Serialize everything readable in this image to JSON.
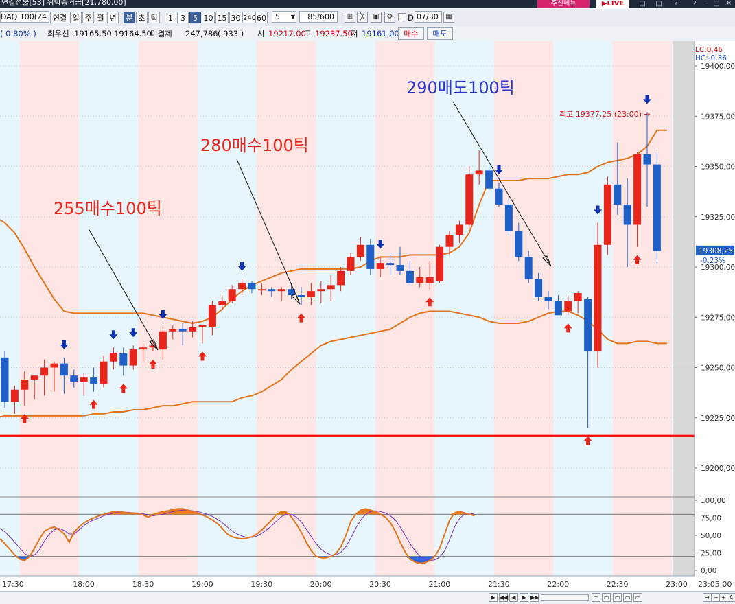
{
  "window": {
    "title": "연결선물[53]  위탁증거금[21,780.00]",
    "badge": "주신메뉴",
    "live_badge": "▶LIVE",
    "controls": [
      "□",
      "□",
      "?",
      "?",
      "─",
      "□",
      "✕"
    ]
  },
  "toolbar": {
    "symbol": "DAQ 100(24.0",
    "period_buttons": [
      {
        "label": "연결",
        "selected": false
      },
      {
        "label": "일",
        "selected": false
      },
      {
        "label": "주",
        "selected": false
      },
      {
        "label": "월",
        "selected": false
      },
      {
        "label": "년",
        "selected": false
      },
      {
        "label": "분",
        "selected": true
      },
      {
        "label": "초",
        "selected": false
      },
      {
        "label": "틱",
        "selected": false
      },
      {
        "label": "1",
        "selected": false
      },
      {
        "label": "3",
        "selected": false
      },
      {
        "label": "5",
        "selected": true
      },
      {
        "label": "10",
        "selected": false
      },
      {
        "label": "15",
        "selected": false
      },
      {
        "label": "30",
        "selected": false
      },
      {
        "label": "240",
        "selected": false
      },
      {
        "label": "60",
        "selected": false
      }
    ],
    "interval_value": "5",
    "count_value": "85/600",
    "d_label": "D",
    "date_value": "07/30"
  },
  "quote": {
    "change_pct": "(    0.80%  )",
    "best_label": "최우선",
    "best_ask": "19165.50",
    "best_bid": "19164.50",
    "oi_label": "미결제",
    "oi_value": "247,786",
    "oi_change": "(    933    )",
    "open_label": "시",
    "open": "19217.00",
    "high_label": "고",
    "high": "19237.50",
    "low_label": "저",
    "low": "19161.00",
    "buy_button": "매수",
    "sell_button": "매도"
  },
  "chart_data": {
    "type": "candlestick",
    "ylim": [
      19190,
      19415
    ],
    "price_ticks": [
      "19400,00",
      "19375,00",
      "19350,00",
      "19325,00",
      "19300,00",
      "19275,00",
      "19250,00",
      "19225,00",
      "19200,00"
    ],
    "time_labels": [
      "17:30",
      "18:00",
      "18:30",
      "19:00",
      "19:30",
      "20:00",
      "20:30",
      "21:00",
      "21:30",
      "22:00",
      "22:30",
      "23:00",
      "23:05:00"
    ],
    "lc_label": "LC:0,46",
    "hc_label": "HC:-0,36",
    "current_price": "19308,25",
    "current_change": "-0,23%",
    "high_marker": "최고 19377,25 (23:00) →",
    "support_level": 19216,
    "annotations": [
      "255매수100틱",
      "280매수100틱",
      "290매도100틱"
    ],
    "candles": [
      {
        "time": "17:20",
        "open": 19263,
        "high": 19265,
        "low": 19255,
        "close": 19255
      },
      {
        "time": "17:25",
        "open": 19255,
        "high": 19258,
        "low": 19230,
        "close": 19233
      },
      {
        "time": "17:30",
        "open": 19233,
        "high": 19241,
        "low": 19227,
        "close": 19239
      },
      {
        "time": "17:35",
        "open": 19239,
        "high": 19248,
        "low": 19231,
        "close": 19244
      },
      {
        "time": "17:40",
        "open": 19244,
        "high": 19246,
        "low": 19234,
        "close": 19246
      },
      {
        "time": "17:45",
        "open": 19246,
        "high": 19254,
        "low": 19236,
        "close": 19250
      },
      {
        "time": "17:50",
        "open": 19250,
        "high": 19253,
        "low": 19238,
        "close": 19252
      },
      {
        "time": "17:55",
        "open": 19252,
        "high": 19255,
        "low": 19237,
        "close": 19246
      },
      {
        "time": "18:00",
        "open": 19246,
        "high": 19249,
        "low": 19240,
        "close": 19243
      },
      {
        "time": "18:05",
        "open": 19243,
        "high": 19247,
        "low": 19236,
        "close": 19245
      },
      {
        "time": "18:10",
        "open": 19245,
        "high": 19250,
        "low": 19238,
        "close": 19242
      },
      {
        "time": "18:15",
        "open": 19242,
        "high": 19256,
        "low": 19240,
        "close": 19253
      },
      {
        "time": "18:20",
        "open": 19253,
        "high": 19260,
        "low": 19249,
        "close": 19257
      },
      {
        "time": "18:25",
        "open": 19257,
        "high": 19260,
        "low": 19246,
        "close": 19251
      },
      {
        "time": "18:30",
        "open": 19251,
        "high": 19261,
        "low": 19249,
        "close": 19259
      },
      {
        "time": "18:35",
        "open": 19259,
        "high": 19262,
        "low": 19253,
        "close": 19260
      },
      {
        "time": "18:40",
        "open": 19260,
        "high": 19264,
        "low": 19258,
        "close": 19261
      },
      {
        "time": "18:45",
        "open": 19259,
        "high": 19270,
        "low": 19254,
        "close": 19268
      },
      {
        "time": "18:50",
        "open": 19268,
        "high": 19271,
        "low": 19264,
        "close": 19269
      },
      {
        "time": "18:55",
        "open": 19269,
        "high": 19272,
        "low": 19261,
        "close": 19268
      },
      {
        "time": "19:00",
        "open": 19268,
        "high": 19273,
        "low": 19265,
        "close": 19270
      },
      {
        "time": "19:05",
        "open": 19270,
        "high": 19271,
        "low": 19262,
        "close": 19271
      },
      {
        "time": "19:10",
        "open": 19270,
        "high": 19283,
        "low": 19266,
        "close": 19281
      },
      {
        "time": "19:15",
        "open": 19281,
        "high": 19286,
        "low": 19279,
        "close": 19283
      },
      {
        "time": "19:20",
        "open": 19283,
        "high": 19291,
        "low": 19282,
        "close": 19289
      },
      {
        "time": "19:25",
        "open": 19289,
        "high": 19294,
        "low": 19286,
        "close": 19292
      },
      {
        "time": "19:30",
        "open": 19292,
        "high": 19293,
        "low": 19287,
        "close": 19289
      },
      {
        "time": "19:35",
        "open": 19289,
        "high": 19292,
        "low": 19286,
        "close": 19289
      },
      {
        "time": "19:40",
        "open": 19289,
        "high": 19290,
        "low": 19285,
        "close": 19288
      },
      {
        "time": "19:45",
        "open": 19288,
        "high": 19290,
        "low": 19283,
        "close": 19289
      },
      {
        "time": "19:50",
        "open": 19289,
        "high": 19292,
        "low": 19284,
        "close": 19286
      },
      {
        "time": "19:55",
        "open": 19286,
        "high": 19290,
        "low": 19281,
        "close": 19285
      },
      {
        "time": "20:00",
        "open": 19285,
        "high": 19292,
        "low": 19281,
        "close": 19288
      },
      {
        "time": "20:05",
        "open": 19288,
        "high": 19293,
        "low": 19282,
        "close": 19289
      },
      {
        "time": "20:10",
        "open": 19289,
        "high": 19296,
        "low": 19283,
        "close": 19291
      },
      {
        "time": "20:15",
        "open": 19291,
        "high": 19300,
        "low": 19288,
        "close": 19298
      },
      {
        "time": "20:20",
        "open": 19298,
        "high": 19307,
        "low": 19296,
        "close": 19305
      },
      {
        "time": "20:25",
        "open": 19305,
        "high": 19315,
        "low": 19303,
        "close": 19311
      },
      {
        "time": "20:30",
        "open": 19311,
        "high": 19314,
        "low": 19296,
        "close": 19299
      },
      {
        "time": "20:35",
        "open": 19299,
        "high": 19305,
        "low": 19295,
        "close": 19302
      },
      {
        "time": "20:40",
        "open": 19302,
        "high": 19306,
        "low": 19296,
        "close": 19301
      },
      {
        "time": "20:45",
        "open": 19301,
        "high": 19310,
        "low": 19296,
        "close": 19298
      },
      {
        "time": "20:50",
        "open": 19298,
        "high": 19303,
        "low": 19291,
        "close": 19292
      },
      {
        "time": "20:55",
        "open": 19292,
        "high": 19300,
        "low": 19290,
        "close": 19295
      },
      {
        "time": "21:00",
        "open": 19292,
        "high": 19303,
        "low": 19289,
        "close": 19295
      },
      {
        "time": "21:05",
        "open": 19293,
        "high": 19311,
        "low": 19292,
        "close": 19310
      },
      {
        "time": "21:10",
        "open": 19310,
        "high": 19318,
        "low": 19306,
        "close": 19316
      },
      {
        "time": "21:15",
        "open": 19316,
        "high": 19323,
        "low": 19312,
        "close": 19321
      },
      {
        "time": "21:20",
        "open": 19321,
        "high": 19350,
        "low": 19319,
        "close": 19346
      },
      {
        "time": "21:25",
        "open": 19346,
        "high": 19358,
        "low": 19341,
        "close": 19348
      },
      {
        "time": "21:30",
        "open": 19348,
        "high": 19351,
        "low": 19338,
        "close": 19339
      },
      {
        "time": "21:35",
        "open": 19339,
        "high": 19342,
        "low": 19330,
        "close": 19331
      },
      {
        "time": "21:40",
        "open": 19331,
        "high": 19334,
        "low": 19316,
        "close": 19318
      },
      {
        "time": "21:45",
        "open": 19318,
        "high": 19322,
        "low": 19303,
        "close": 19305
      },
      {
        "time": "21:50",
        "open": 19305,
        "high": 19308,
        "low": 19292,
        "close": 19294
      },
      {
        "time": "21:55",
        "open": 19294,
        "high": 19297,
        "low": 19283,
        "close": 19285
      },
      {
        "time": "22:00",
        "open": 19285,
        "high": 19288,
        "low": 19279,
        "close": 19283
      },
      {
        "time": "22:05",
        "open": 19283,
        "high": 19286,
        "low": 19276,
        "close": 19276
      },
      {
        "time": "22:10",
        "open": 19278,
        "high": 19286,
        "low": 19276,
        "close": 19283
      },
      {
        "time": "22:15",
        "open": 19283,
        "high": 19288,
        "low": 19277,
        "close": 19287
      },
      {
        "time": "22:20",
        "open": 19284,
        "high": 19285,
        "low": 19220,
        "close": 19258
      },
      {
        "time": "22:25",
        "open": 19258,
        "high": 19322,
        "low": 19250,
        "close": 19311
      },
      {
        "time": "22:30",
        "open": 19311,
        "high": 19345,
        "low": 19306,
        "close": 19341
      },
      {
        "time": "22:35",
        "open": 19341,
        "high": 19362,
        "low": 19326,
        "close": 19331
      },
      {
        "time": "22:40",
        "open": 19331,
        "high": 19344,
        "low": 19300,
        "close": 19321
      },
      {
        "time": "22:45",
        "open": 19321,
        "high": 19357,
        "low": 19310,
        "close": 19356
      },
      {
        "time": "22:50",
        "open": 19356,
        "high": 19377,
        "low": 19330,
        "close": 19351
      },
      {
        "time": "22:55",
        "open": 19351,
        "high": 19357,
        "low": 19302,
        "close": 19308
      }
    ],
    "bands": {
      "upper": [
        19325,
        19322,
        19317,
        19309,
        19300,
        19292,
        19284,
        19278,
        19277,
        19277,
        19277,
        19277,
        19277,
        19277,
        19277,
        19277,
        19276,
        19275,
        19274,
        19273,
        19272,
        19273,
        19275,
        19279,
        19284,
        19288,
        19291,
        19293,
        19295,
        19297,
        19298,
        19299,
        19299,
        19299,
        19299,
        19299,
        19299,
        19300,
        19303,
        19305,
        19305,
        19305,
        19306,
        19306,
        19306,
        19306,
        19307,
        19310,
        19317,
        19331,
        19343,
        19343,
        19343,
        19343,
        19344,
        19344,
        19344,
        19345,
        19346,
        19346,
        19347,
        19350,
        19352,
        19353,
        19354,
        19356,
        19360,
        19368,
        19368
      ],
      "middle": [
        19274,
        19274,
        19274,
        19274,
        19274,
        19274,
        19274,
        19274,
        19274,
        19274,
        19274,
        19274,
        19274,
        19274,
        19274,
        19274,
        19274,
        19274,
        19274,
        19274,
        19274,
        19274,
        19274,
        19274,
        19274,
        19274,
        19274,
        19274,
        19274,
        19274,
        19274,
        19274,
        19274,
        19274,
        19274,
        19274,
        19274,
        19274,
        19274,
        19274,
        19274,
        19274,
        19274,
        19274,
        19274,
        19274,
        19274,
        19274,
        19274,
        19274,
        19274,
        19274,
        19274,
        19274,
        19274,
        19274,
        19274,
        19274,
        19274,
        19274,
        19274,
        19274,
        19274,
        19274,
        19274,
        19274,
        19274,
        19274,
        19274
      ],
      "lower": [
        19225,
        19226,
        19226,
        19226,
        19226,
        19226,
        19226,
        19226,
        19226,
        19226,
        19227,
        19227,
        19228,
        19228,
        19229,
        19229,
        19230,
        19231,
        19231,
        19232,
        19233,
        19233,
        19233,
        19233,
        19233,
        19235,
        19236,
        19238,
        19241,
        19244,
        19249,
        19253,
        19257,
        19261,
        19263,
        19264,
        19265,
        19266,
        19267,
        19268,
        19269,
        19272,
        19275,
        19277,
        19278,
        19278,
        19278,
        19277,
        19276,
        19275,
        19273,
        19272,
        19272,
        19272,
        19273,
        19275,
        19277,
        19278,
        19278,
        19276,
        19273,
        19269,
        19264,
        19262,
        19262,
        19263,
        19263,
        19262,
        19262
      ]
    },
    "buy_signals": [
      2,
      9,
      12,
      15,
      20,
      30,
      43,
      57,
      59,
      64
    ],
    "sell_signals": [
      -1,
      6,
      11,
      13,
      16,
      24,
      38,
      50,
      60,
      65,
      67
    ],
    "oscillator": {
      "ticks": [
        "100,00",
        "75,00",
        "50,00",
        "25,00",
        "0,00"
      ],
      "levels": [
        80,
        20
      ],
      "k": [
        45,
        38,
        30,
        22,
        16,
        14,
        20,
        32,
        45,
        56,
        60,
        62,
        58,
        52,
        40,
        55,
        62,
        68,
        72,
        75,
        78,
        80,
        82,
        84,
        84,
        83,
        82,
        82,
        81,
        79,
        76,
        80,
        82,
        84,
        85,
        87,
        88,
        88,
        86,
        84,
        82,
        79,
        76,
        72,
        67,
        60,
        52,
        48,
        46,
        45,
        46,
        48,
        52,
        58,
        65,
        72,
        80,
        84,
        83,
        76,
        66,
        54,
        40,
        28,
        20,
        18,
        18,
        20,
        24,
        34,
        50,
        70,
        80,
        86,
        88,
        86,
        84,
        80,
        76,
        68,
        56,
        40,
        26,
        16,
        12,
        10,
        11,
        14,
        20,
        32,
        52,
        72,
        82,
        84,
        82,
        80,
        78
      ],
      "d": [
        60,
        55,
        48,
        40,
        32,
        24,
        20,
        22,
        30,
        42,
        52,
        58,
        60,
        57,
        52,
        52,
        58,
        64,
        69,
        72,
        75,
        78,
        80,
        82,
        83,
        83,
        83,
        82,
        82,
        81,
        79,
        78,
        79,
        80,
        82,
        84,
        85,
        86,
        86,
        85,
        84,
        82,
        80,
        77,
        73,
        68,
        62,
        56,
        52,
        49,
        47,
        47,
        49,
        53,
        58,
        64,
        71,
        77,
        80,
        80,
        76,
        69,
        59,
        48,
        38,
        30,
        25,
        22,
        22,
        26,
        34,
        46,
        60,
        72,
        80,
        84,
        85,
        84,
        82,
        78,
        72,
        62,
        50,
        38,
        28,
        20,
        16,
        14,
        15,
        19,
        28,
        44,
        62,
        74,
        80,
        82,
        80
      ]
    }
  }
}
